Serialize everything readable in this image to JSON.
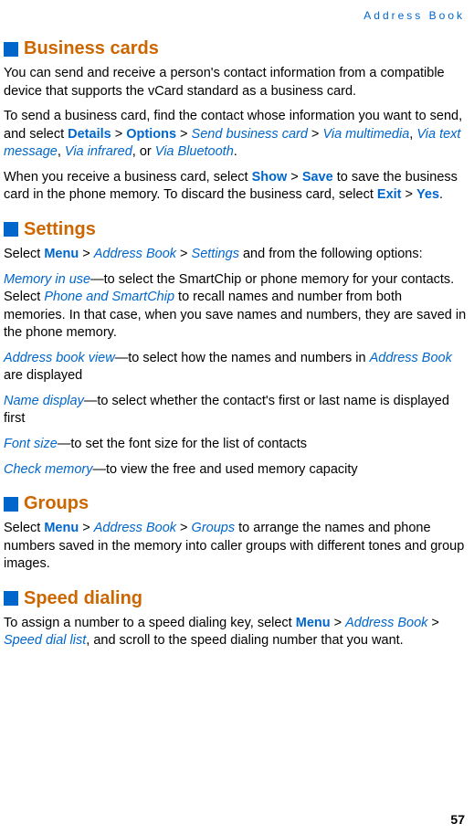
{
  "header": "Address Book",
  "sections": {
    "business_cards": {
      "title": "Business cards",
      "p1_text1": "You can send and receive a person's contact information from a compatible device that supports the vCard standard as a business card.",
      "p2_text1": "To send a business card, find the contact whose information you want to send, and select ",
      "p2_details": "Details",
      "p2_gt1": " > ",
      "p2_options": "Options",
      "p2_gt2": " > ",
      "p2_send": "Send business card",
      "p2_gt3": " > ",
      "p2_via_mm": "Via multimedia",
      "p2_comma1": ", ",
      "p2_via_text": "Via text message",
      "p2_comma2": ", ",
      "p2_via_ir": "Via infrared",
      "p2_comma3": ", or ",
      "p2_via_bt": "Via Bluetooth",
      "p2_period": ".",
      "p3_text1": "When you receive a business card, select ",
      "p3_show": "Show",
      "p3_gt1": " > ",
      "p3_save": "Save",
      "p3_text2": " to save the business card in the phone memory. To discard the business card, select ",
      "p3_exit": "Exit",
      "p3_gt2": " > ",
      "p3_yes": "Yes",
      "p3_period": "."
    },
    "settings": {
      "title": "Settings",
      "p1_text1": "Select ",
      "p1_menu": "Menu",
      "p1_gt1": " > ",
      "p1_ab": "Address Book",
      "p1_gt2": " > ",
      "p1_settings": "Settings",
      "p1_text2": " and from the following options:",
      "p2_memory": "Memory in use",
      "p2_text1": "—to select the SmartChip or phone memory for your contacts. Select ",
      "p2_phone_sc": "Phone and SmartChip",
      "p2_text2": " to recall names and number from both memories. In that case, when you save names and numbers, they are saved in the phone memory.",
      "p3_abv": "Address book view",
      "p3_text1": "—to select how the names and numbers in ",
      "p3_ab": "Address Book",
      "p3_text2": " are displayed",
      "p4_name": "Name display",
      "p4_text1": "—to select whether the contact's first or last name is displayed first",
      "p5_font": "Font size",
      "p5_text1": "—to set the font size for the list of contacts",
      "p6_check": "Check memory",
      "p6_text1": "—to view the free and used memory capacity"
    },
    "groups": {
      "title": "Groups",
      "p1_text1": "Select ",
      "p1_menu": "Menu",
      "p1_gt1": " > ",
      "p1_ab": "Address Book",
      "p1_gt2": " > ",
      "p1_groups": "Groups",
      "p1_text2": " to arrange the names and phone numbers saved in the memory into caller groups with different tones and group images."
    },
    "speed_dialing": {
      "title": "Speed dialing",
      "p1_text1": "To assign a number to a speed dialing key, select ",
      "p1_menu": "Menu",
      "p1_gt1": " > ",
      "p1_ab": "Address Book",
      "p1_gt2": " > ",
      "p1_sdl": "Speed dial list",
      "p1_text2": ", and scroll to the speed dialing number that you want."
    }
  },
  "page_number": "57"
}
